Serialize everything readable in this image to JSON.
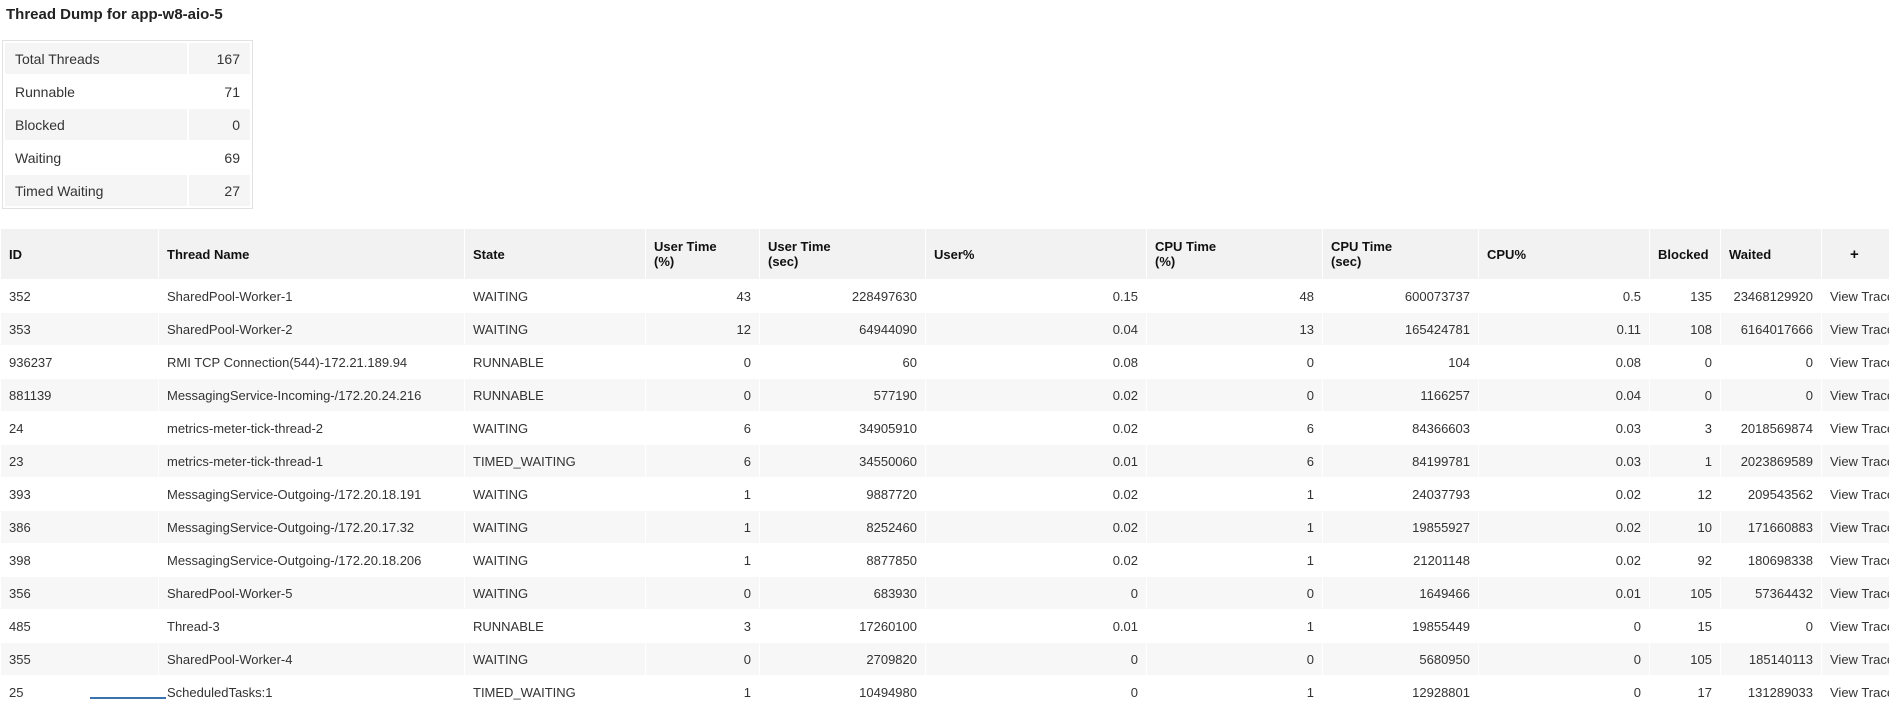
{
  "title": "Thread Dump for app-w8-aio-5",
  "colors": {
    "header_bg": "#f2f2f2",
    "row_alt_bg": "#f7f7f7",
    "summary_row_bg": "#f5f5f5",
    "partial_row_accent": "#3b73af"
  },
  "summary": {
    "rows": [
      {
        "label": "Total Threads",
        "value": "167"
      },
      {
        "label": "Runnable",
        "value": "71"
      },
      {
        "label": "Blocked",
        "value": "0"
      },
      {
        "label": "Waiting",
        "value": "69"
      },
      {
        "label": "Timed Waiting",
        "value": "27"
      }
    ]
  },
  "thread_table": {
    "view_trace_label": "View Trace",
    "columns": [
      {
        "key": "id",
        "label": "ID"
      },
      {
        "key": "thread-name",
        "label": "Thread Name"
      },
      {
        "key": "state",
        "label": "State"
      },
      {
        "key": "user-time-pct",
        "label": "User Time\n(%)"
      },
      {
        "key": "user-time-sec",
        "label": "User Time\n(sec)"
      },
      {
        "key": "user-pct",
        "label": "User%"
      },
      {
        "key": "cpu-time-pct",
        "label": "CPU Time\n(%)"
      },
      {
        "key": "cpu-time-sec",
        "label": "CPU Time\n(sec)"
      },
      {
        "key": "cpu-pct",
        "label": "CPU%"
      },
      {
        "key": "blocked",
        "label": "Blocked"
      },
      {
        "key": "waited",
        "label": "Waited"
      },
      {
        "key": "add-column",
        "label": "+"
      }
    ],
    "rows": [
      [
        "352",
        "SharedPool-Worker-1",
        "WAITING",
        "43",
        "228497630",
        "0.15",
        "48",
        "600073737",
        "0.5",
        "135",
        "23468129920"
      ],
      [
        "353",
        "SharedPool-Worker-2",
        "WAITING",
        "12",
        "64944090",
        "0.04",
        "13",
        "165424781",
        "0.11",
        "108",
        "6164017666"
      ],
      [
        "936237",
        "RMI TCP Connection(544)-172.21.189.94",
        "RUNNABLE",
        "0",
        "60",
        "0.08",
        "0",
        "104",
        "0.08",
        "0",
        "0"
      ],
      [
        "881139",
        "MessagingService-Incoming-/172.20.24.216",
        "RUNNABLE",
        "0",
        "577190",
        "0.02",
        "0",
        "1166257",
        "0.04",
        "0",
        "0"
      ],
      [
        "24",
        "metrics-meter-tick-thread-2",
        "WAITING",
        "6",
        "34905910",
        "0.02",
        "6",
        "84366603",
        "0.03",
        "3",
        "2018569874"
      ],
      [
        "23",
        "metrics-meter-tick-thread-1",
        "TIMED_WAITING",
        "6",
        "34550060",
        "0.01",
        "6",
        "84199781",
        "0.03",
        "1",
        "2023869589"
      ],
      [
        "393",
        "MessagingService-Outgoing-/172.20.18.191",
        "WAITING",
        "1",
        "9887720",
        "0.02",
        "1",
        "24037793",
        "0.02",
        "12",
        "209543562"
      ],
      [
        "386",
        "MessagingService-Outgoing-/172.20.17.32",
        "WAITING",
        "1",
        "8252460",
        "0.02",
        "1",
        "19855927",
        "0.02",
        "10",
        "171660883"
      ],
      [
        "398",
        "MessagingService-Outgoing-/172.20.18.206",
        "WAITING",
        "1",
        "8877850",
        "0.02",
        "1",
        "21201148",
        "0.02",
        "92",
        "180698338"
      ],
      [
        "356",
        "SharedPool-Worker-5",
        "WAITING",
        "0",
        "683930",
        "0",
        "0",
        "1649466",
        "0.01",
        "105",
        "57364432"
      ],
      [
        "485",
        "Thread-3",
        "RUNNABLE",
        "3",
        "17260100",
        "0.01",
        "1",
        "19855449",
        "0",
        "15",
        "0"
      ],
      [
        "355",
        "SharedPool-Worker-4",
        "WAITING",
        "0",
        "2709820",
        "0",
        "0",
        "5680950",
        "0",
        "105",
        "185140113"
      ],
      [
        "25",
        "ScheduledTasks:1",
        "TIMED_WAITING",
        "1",
        "10494980",
        "0",
        "1",
        "12928801",
        "0",
        "17",
        "131289033"
      ]
    ]
  }
}
